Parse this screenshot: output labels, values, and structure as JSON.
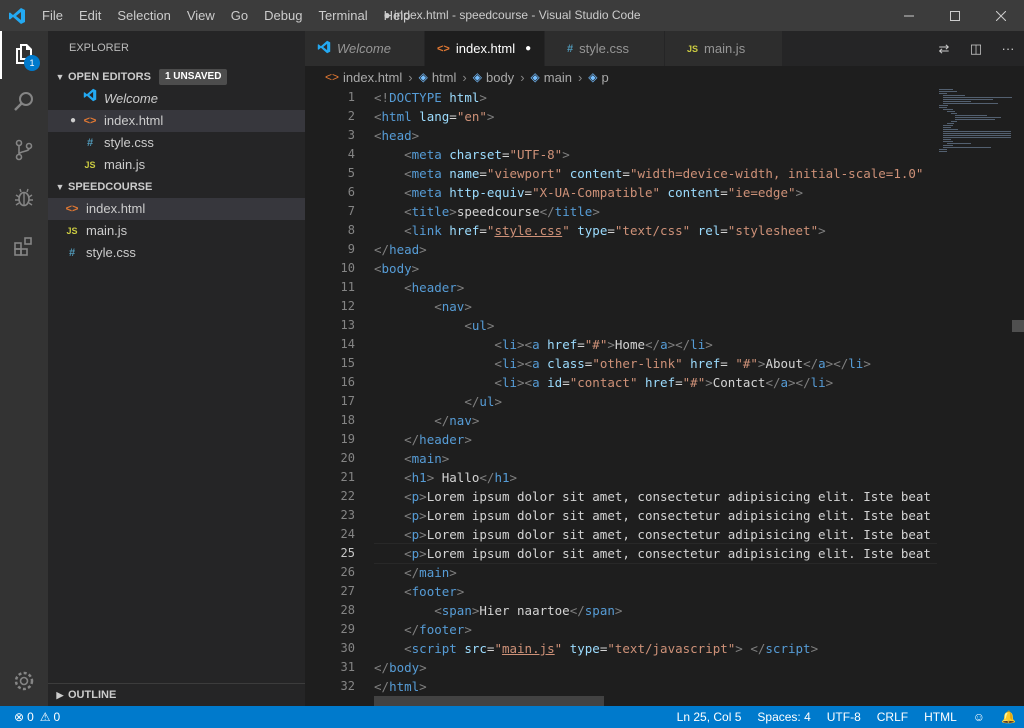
{
  "menu": [
    "File",
    "Edit",
    "Selection",
    "View",
    "Go",
    "Debug",
    "Terminal",
    "Help"
  ],
  "window_title": "● index.html - speedcourse - Visual Studio Code",
  "activity_badge": "1",
  "explorer": {
    "title": "EXPLORER",
    "open_editors_label": "OPEN EDITORS",
    "unsaved_label": "1 UNSAVED",
    "open_editors": [
      {
        "icon": "vscode",
        "name": "Welcome"
      },
      {
        "icon": "html",
        "name": "index.html",
        "dot": "●"
      },
      {
        "icon": "css",
        "name": "style.css"
      },
      {
        "icon": "js",
        "name": "main.js"
      }
    ],
    "project_label": "SPEEDCOURSE",
    "files": [
      {
        "icon": "html",
        "name": "index.html"
      },
      {
        "icon": "js",
        "name": "main.js"
      },
      {
        "icon": "css",
        "name": "style.css"
      }
    ],
    "outline_label": "OUTLINE"
  },
  "tabs": [
    {
      "name": "Welcome",
      "icon": "vscode"
    },
    {
      "name": "index.html",
      "icon": "html",
      "dot": "●"
    },
    {
      "name": "style.css",
      "icon": "css"
    },
    {
      "name": "main.js",
      "icon": "js"
    }
  ],
  "breadcrumb": [
    "index.html",
    "html",
    "body",
    "main",
    "p"
  ],
  "line_numbers": [
    "1",
    "2",
    "3",
    "4",
    "5",
    "6",
    "7",
    "8",
    "9",
    "10",
    "11",
    "12",
    "13",
    "14",
    "15",
    "16",
    "17",
    "18",
    "19",
    "20",
    "21",
    "22",
    "23",
    "24",
    "25",
    "26",
    "27",
    "28",
    "29",
    "30",
    "31",
    "32"
  ],
  "current_line": 25,
  "status": {
    "errors": "0",
    "warnings": "0",
    "position": "Ln 25, Col 5",
    "spaces": "Spaces: 4",
    "encoding": "UTF-8",
    "eol": "CRLF",
    "language": "HTML"
  },
  "code_lines": [
    [
      [
        "t-br",
        "<!"
      ],
      [
        "t-tag",
        "DOCTYPE "
      ],
      [
        "t-attr",
        "html"
      ],
      [
        "t-br",
        ">"
      ]
    ],
    [
      [
        "t-br",
        "<"
      ],
      [
        "t-tag",
        "html "
      ],
      [
        "t-attr",
        "lang"
      ],
      [
        "t-txt",
        "="
      ],
      [
        "t-str",
        "\"en\""
      ],
      [
        "t-br",
        ">"
      ]
    ],
    [
      [
        "t-br",
        "<"
      ],
      [
        "t-tag",
        "head"
      ],
      [
        "t-br",
        ">"
      ]
    ],
    [
      [
        "t-txt",
        "    "
      ],
      [
        "t-br",
        "<"
      ],
      [
        "t-tag",
        "meta "
      ],
      [
        "t-attr",
        "charset"
      ],
      [
        "t-txt",
        "="
      ],
      [
        "t-str",
        "\"UTF-8\""
      ],
      [
        "t-br",
        ">"
      ]
    ],
    [
      [
        "t-txt",
        "    "
      ],
      [
        "t-br",
        "<"
      ],
      [
        "t-tag",
        "meta "
      ],
      [
        "t-attr",
        "name"
      ],
      [
        "t-txt",
        "="
      ],
      [
        "t-str",
        "\"viewport\""
      ],
      [
        "t-txt",
        " "
      ],
      [
        "t-attr",
        "content"
      ],
      [
        "t-txt",
        "="
      ],
      [
        "t-str",
        "\"width=device-width, initial-scale=1.0\""
      ]
    ],
    [
      [
        "t-txt",
        "    "
      ],
      [
        "t-br",
        "<"
      ],
      [
        "t-tag",
        "meta "
      ],
      [
        "t-attr",
        "http-equiv"
      ],
      [
        "t-txt",
        "="
      ],
      [
        "t-str",
        "\"X-UA-Compatible\""
      ],
      [
        "t-txt",
        " "
      ],
      [
        "t-attr",
        "content"
      ],
      [
        "t-txt",
        "="
      ],
      [
        "t-str",
        "\"ie=edge\""
      ],
      [
        "t-br",
        ">"
      ]
    ],
    [
      [
        "t-txt",
        "    "
      ],
      [
        "t-br",
        "<"
      ],
      [
        "t-tag",
        "title"
      ],
      [
        "t-br",
        ">"
      ],
      [
        "t-txt",
        "speedcourse"
      ],
      [
        "t-br",
        "</"
      ],
      [
        "t-tag",
        "title"
      ],
      [
        "t-br",
        ">"
      ]
    ],
    [
      [
        "t-txt",
        "    "
      ],
      [
        "t-br",
        "<"
      ],
      [
        "t-tag",
        "link "
      ],
      [
        "t-attr",
        "href"
      ],
      [
        "t-txt",
        "="
      ],
      [
        "t-str",
        "\""
      ],
      [
        "t-str t-link",
        "style.css"
      ],
      [
        "t-str",
        "\""
      ],
      [
        "t-txt",
        " "
      ],
      [
        "t-attr",
        "type"
      ],
      [
        "t-txt",
        "="
      ],
      [
        "t-str",
        "\"text/css\""
      ],
      [
        "t-txt",
        " "
      ],
      [
        "t-attr",
        "rel"
      ],
      [
        "t-txt",
        "="
      ],
      [
        "t-str",
        "\"stylesheet\""
      ],
      [
        "t-br",
        ">"
      ]
    ],
    [
      [
        "t-br",
        "</"
      ],
      [
        "t-tag",
        "head"
      ],
      [
        "t-br",
        ">"
      ]
    ],
    [
      [
        "t-br",
        "<"
      ],
      [
        "t-tag",
        "body"
      ],
      [
        "t-br",
        ">"
      ]
    ],
    [
      [
        "t-txt",
        "    "
      ],
      [
        "t-br",
        "<"
      ],
      [
        "t-tag",
        "header"
      ],
      [
        "t-br",
        ">"
      ]
    ],
    [
      [
        "t-txt",
        "        "
      ],
      [
        "t-br",
        "<"
      ],
      [
        "t-tag",
        "nav"
      ],
      [
        "t-br",
        ">"
      ]
    ],
    [
      [
        "t-txt",
        "            "
      ],
      [
        "t-br",
        "<"
      ],
      [
        "t-tag",
        "ul"
      ],
      [
        "t-br",
        ">"
      ]
    ],
    [
      [
        "t-txt",
        "                "
      ],
      [
        "t-br",
        "<"
      ],
      [
        "t-tag",
        "li"
      ],
      [
        "t-br",
        "><"
      ],
      [
        "t-tag",
        "a "
      ],
      [
        "t-attr",
        "href"
      ],
      [
        "t-txt",
        "="
      ],
      [
        "t-str",
        "\"#\""
      ],
      [
        "t-br",
        ">"
      ],
      [
        "t-txt",
        "Home"
      ],
      [
        "t-br",
        "</"
      ],
      [
        "t-tag",
        "a"
      ],
      [
        "t-br",
        "></"
      ],
      [
        "t-tag",
        "li"
      ],
      [
        "t-br",
        ">"
      ]
    ],
    [
      [
        "t-txt",
        "                "
      ],
      [
        "t-br",
        "<"
      ],
      [
        "t-tag",
        "li"
      ],
      [
        "t-br",
        "><"
      ],
      [
        "t-tag",
        "a "
      ],
      [
        "t-attr",
        "class"
      ],
      [
        "t-txt",
        "="
      ],
      [
        "t-str",
        "\"other-link\""
      ],
      [
        "t-txt",
        " "
      ],
      [
        "t-attr",
        "href"
      ],
      [
        "t-txt",
        "= "
      ],
      [
        "t-str",
        "\"#\""
      ],
      [
        "t-br",
        ">"
      ],
      [
        "t-txt",
        "About"
      ],
      [
        "t-br",
        "</"
      ],
      [
        "t-tag",
        "a"
      ],
      [
        "t-br",
        "></"
      ],
      [
        "t-tag",
        "li"
      ],
      [
        "t-br",
        ">"
      ]
    ],
    [
      [
        "t-txt",
        "                "
      ],
      [
        "t-br",
        "<"
      ],
      [
        "t-tag",
        "li"
      ],
      [
        "t-br",
        "><"
      ],
      [
        "t-tag",
        "a "
      ],
      [
        "t-attr",
        "id"
      ],
      [
        "t-txt",
        "="
      ],
      [
        "t-str",
        "\"contact\""
      ],
      [
        "t-txt",
        " "
      ],
      [
        "t-attr",
        "href"
      ],
      [
        "t-txt",
        "="
      ],
      [
        "t-str",
        "\"#\""
      ],
      [
        "t-br",
        ">"
      ],
      [
        "t-txt",
        "Contact"
      ],
      [
        "t-br",
        "</"
      ],
      [
        "t-tag",
        "a"
      ],
      [
        "t-br",
        "></"
      ],
      [
        "t-tag",
        "li"
      ],
      [
        "t-br",
        ">"
      ]
    ],
    [
      [
        "t-txt",
        "            "
      ],
      [
        "t-br",
        "</"
      ],
      [
        "t-tag",
        "ul"
      ],
      [
        "t-br",
        ">"
      ]
    ],
    [
      [
        "t-txt",
        "        "
      ],
      [
        "t-br",
        "</"
      ],
      [
        "t-tag",
        "nav"
      ],
      [
        "t-br",
        ">"
      ]
    ],
    [
      [
        "t-txt",
        "    "
      ],
      [
        "t-br",
        "</"
      ],
      [
        "t-tag",
        "header"
      ],
      [
        "t-br",
        ">"
      ]
    ],
    [
      [
        "t-txt",
        "    "
      ],
      [
        "t-br",
        "<"
      ],
      [
        "t-tag",
        "main"
      ],
      [
        "t-br",
        ">"
      ]
    ],
    [
      [
        "t-txt",
        "    "
      ],
      [
        "t-br",
        "<"
      ],
      [
        "t-tag",
        "h1"
      ],
      [
        "t-br",
        ">"
      ],
      [
        "t-txt",
        " Hallo"
      ],
      [
        "t-br",
        "</"
      ],
      [
        "t-tag",
        "h1"
      ],
      [
        "t-br",
        ">"
      ]
    ],
    [
      [
        "t-txt",
        "    "
      ],
      [
        "t-br",
        "<"
      ],
      [
        "t-tag",
        "p"
      ],
      [
        "t-br",
        ">"
      ],
      [
        "t-txt",
        "Lorem ipsum dolor sit amet, consectetur adipisicing elit. Iste beat"
      ]
    ],
    [
      [
        "t-txt",
        "    "
      ],
      [
        "t-br",
        "<"
      ],
      [
        "t-tag",
        "p"
      ],
      [
        "t-br",
        ">"
      ],
      [
        "t-txt",
        "Lorem ipsum dolor sit amet, consectetur adipisicing elit. Iste beat"
      ]
    ],
    [
      [
        "t-txt",
        "    "
      ],
      [
        "t-br",
        "<"
      ],
      [
        "t-tag",
        "p"
      ],
      [
        "t-br",
        ">"
      ],
      [
        "t-txt",
        "Lorem ipsum dolor sit amet, consectetur adipisicing elit. Iste beat"
      ]
    ],
    [
      [
        "t-txt",
        "    "
      ],
      [
        "t-br",
        "<"
      ],
      [
        "t-tag",
        "p"
      ],
      [
        "t-br",
        ">"
      ],
      [
        "t-txt",
        "Lorem ipsum dolor sit amet, consectetur adipisicing elit. Iste beat"
      ]
    ],
    [
      [
        "t-txt",
        "    "
      ],
      [
        "t-br",
        "</"
      ],
      [
        "t-tag",
        "main"
      ],
      [
        "t-br",
        ">"
      ]
    ],
    [
      [
        "t-txt",
        "    "
      ],
      [
        "t-br",
        "<"
      ],
      [
        "t-tag",
        "footer"
      ],
      [
        "t-br",
        ">"
      ]
    ],
    [
      [
        "t-txt",
        "        "
      ],
      [
        "t-br",
        "<"
      ],
      [
        "t-tag",
        "span"
      ],
      [
        "t-br",
        ">"
      ],
      [
        "t-txt",
        "Hier naartoe"
      ],
      [
        "t-br",
        "</"
      ],
      [
        "t-tag",
        "span"
      ],
      [
        "t-br",
        ">"
      ]
    ],
    [
      [
        "t-txt",
        "    "
      ],
      [
        "t-br",
        "</"
      ],
      [
        "t-tag",
        "footer"
      ],
      [
        "t-br",
        ">"
      ]
    ],
    [
      [
        "t-txt",
        "    "
      ],
      [
        "t-br",
        "<"
      ],
      [
        "t-tag",
        "script "
      ],
      [
        "t-attr",
        "src"
      ],
      [
        "t-txt",
        "="
      ],
      [
        "t-str",
        "\""
      ],
      [
        "t-str t-link",
        "main.js"
      ],
      [
        "t-str",
        "\""
      ],
      [
        "t-txt",
        " "
      ],
      [
        "t-attr",
        "type"
      ],
      [
        "t-txt",
        "="
      ],
      [
        "t-str",
        "\"text/javascript\""
      ],
      [
        "t-br",
        "> </"
      ],
      [
        "t-tag",
        "script"
      ],
      [
        "t-br",
        ">"
      ]
    ],
    [
      [
        "t-br",
        "</"
      ],
      [
        "t-tag",
        "body"
      ],
      [
        "t-br",
        ">"
      ]
    ],
    [
      [
        "t-br",
        "</"
      ],
      [
        "t-tag",
        "html"
      ],
      [
        "t-br",
        ">"
      ]
    ]
  ]
}
